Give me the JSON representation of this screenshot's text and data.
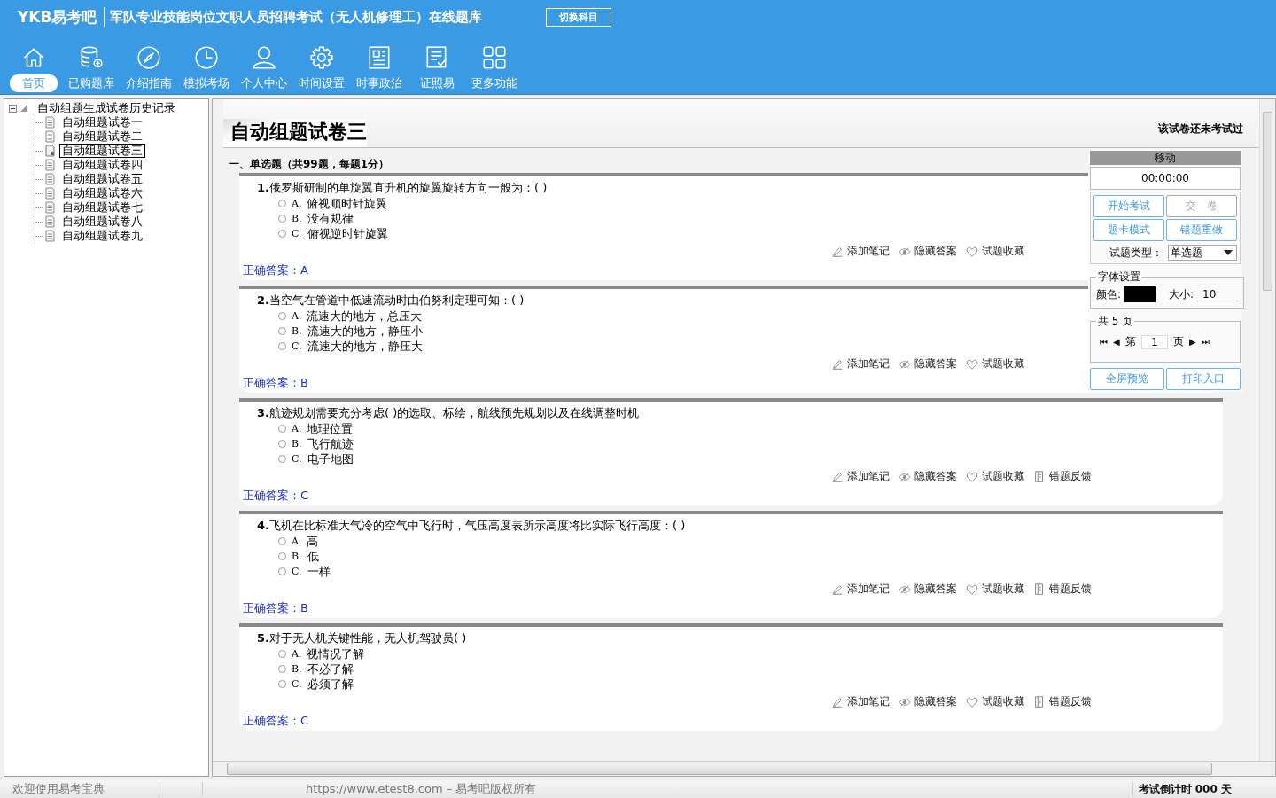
{
  "header": {
    "logo": "YKB易考吧",
    "title": "军队专业技能岗位文职人员招聘考试（无人机修理工）在线题库",
    "switch_button": "切换科目"
  },
  "nav": [
    {
      "label": "首页",
      "kind": "home",
      "selected": true
    },
    {
      "label": "已购题库",
      "kind": "database",
      "selected": false
    },
    {
      "label": "介绍指南",
      "kind": "compass",
      "selected": false
    },
    {
      "label": "模拟考场",
      "kind": "clock",
      "selected": false
    },
    {
      "label": "个人中心",
      "kind": "user",
      "selected": false
    },
    {
      "label": "时间设置",
      "kind": "gear",
      "selected": false
    },
    {
      "label": "时事政治",
      "kind": "news",
      "selected": false
    },
    {
      "label": "证照易",
      "kind": "list",
      "selected": false
    },
    {
      "label": "更多功能",
      "kind": "grid",
      "selected": false
    }
  ],
  "tree": {
    "label": "自动组题生成试卷历史记录",
    "expanded": true,
    "children": [
      {
        "label": "自动组题试卷一",
        "selected": false
      },
      {
        "label": "自动组题试卷二",
        "selected": false
      },
      {
        "label": "自动组题试卷三",
        "selected": true
      },
      {
        "label": "自动组题试卷四",
        "selected": false
      },
      {
        "label": "自动组题试卷五",
        "selected": false
      },
      {
        "label": "自动组题试卷六",
        "selected": false
      },
      {
        "label": "自动组题试卷七",
        "selected": false
      },
      {
        "label": "自动组题试卷八",
        "selected": false
      },
      {
        "label": "自动组题试卷九",
        "selected": false
      }
    ]
  },
  "paper": {
    "title": "自动组题试卷三",
    "status": "该试卷还未考试过",
    "section": "一、单选题（共99题，每题1分）",
    "questions": [
      {
        "number": "1.",
        "text": "俄罗斯研制的单旋翼直升机的旋翼旋转方向一般为：( )",
        "options": [
          {
            "letter": "A.",
            "text": "俯视顺时针旋翼",
            "selected": false
          },
          {
            "letter": "B.",
            "text": "没有规律",
            "selected": false
          },
          {
            "letter": "C.",
            "text": "俯视逆时针旋翼",
            "selected": false
          }
        ],
        "answer": "正确答案：A",
        "actions": [
          {
            "kind": "note",
            "label": "添加笔记"
          },
          {
            "kind": "hide",
            "label": "隐藏答案"
          },
          {
            "kind": "favorite",
            "label": "试题收藏"
          }
        ]
      },
      {
        "number": "2.",
        "text": "当空气在管道中低速流动时由伯努利定理可知：( )",
        "options": [
          {
            "letter": "A.",
            "text": "流速大的地方，总压大",
            "selected": false
          },
          {
            "letter": "B.",
            "text": "流速大的地方，静压小",
            "selected": false
          },
          {
            "letter": "C.",
            "text": "流速大的地方，静压大",
            "selected": false
          }
        ],
        "answer": "正确答案：B",
        "actions": [
          {
            "kind": "note",
            "label": "添加笔记"
          },
          {
            "kind": "hide",
            "label": "隐藏答案"
          },
          {
            "kind": "favorite",
            "label": "试题收藏"
          }
        ]
      },
      {
        "number": "3.",
        "text": "航迹规划需要充分考虑( )的选取、标绘，航线预先规划以及在线调整时机",
        "options": [
          {
            "letter": "A.",
            "text": "地理位置",
            "selected": false
          },
          {
            "letter": "B.",
            "text": "飞行航迹",
            "selected": false
          },
          {
            "letter": "C.",
            "text": "电子地图",
            "selected": false
          }
        ],
        "answer": "正确答案：C",
        "actions": [
          {
            "kind": "note",
            "label": "添加笔记"
          },
          {
            "kind": "hide",
            "label": "隐藏答案"
          },
          {
            "kind": "favorite",
            "label": "试题收藏"
          },
          {
            "kind": "feedback",
            "label": "错题反馈"
          }
        ]
      },
      {
        "number": "4.",
        "text": "飞机在比标准大气冷的空气中飞行时，气压高度表所示高度将比实际飞行高度：( )",
        "options": [
          {
            "letter": "A.",
            "text": "高",
            "selected": false
          },
          {
            "letter": "B.",
            "text": "低",
            "selected": false
          },
          {
            "letter": "C.",
            "text": "一样",
            "selected": false
          }
        ],
        "answer": "正确答案：B",
        "actions": [
          {
            "kind": "note",
            "label": "添加笔记"
          },
          {
            "kind": "hide",
            "label": "隐藏答案"
          },
          {
            "kind": "favorite",
            "label": "试题收藏"
          },
          {
            "kind": "feedback",
            "label": "错题反馈"
          }
        ]
      },
      {
        "number": "5.",
        "text": "对于无人机关键性能，无人机驾驶员( )",
        "options": [
          {
            "letter": "A.",
            "text": "视情况了解",
            "selected": false
          },
          {
            "letter": "B.",
            "text": "不必了解",
            "selected": false
          },
          {
            "letter": "C.",
            "text": "必须了解",
            "selected": false
          }
        ],
        "answer": "正确答案：C",
        "actions": [
          {
            "kind": "note",
            "label": "添加笔记"
          },
          {
            "kind": "hide",
            "label": "隐藏答案"
          },
          {
            "kind": "favorite",
            "label": "试题收藏"
          },
          {
            "kind": "feedback",
            "label": "错题反馈"
          }
        ]
      }
    ]
  },
  "panel": {
    "title": "移动",
    "timer": "00:00:00",
    "buttons": [
      {
        "label": "开始考试",
        "disabled": false
      },
      {
        "label": "交　卷",
        "disabled": true
      },
      {
        "label": "题卡模式",
        "disabled": false
      },
      {
        "label": "错题重做",
        "disabled": false
      }
    ],
    "type_label": "试题类型：",
    "type_value": "单选题",
    "font": {
      "legend": "字体设置",
      "color_label": "颜色:",
      "color": "#000000",
      "size_label": "大小:",
      "size": "10"
    },
    "pages": {
      "legend": "共 5 页",
      "first": "⏮",
      "prev": "◀",
      "before": "第",
      "page": "1",
      "after": "页",
      "next": "▶",
      "last": "⏭"
    },
    "bottom_buttons": [
      {
        "label": "全屏预览"
      },
      {
        "label": "打印入口"
      }
    ]
  },
  "status_bar": {
    "welcome": "欢迎使用易考宝典",
    "copyright": "https://www.etest8.com – 易考吧版权所有",
    "countdown": "考试倒计时 000 天"
  }
}
